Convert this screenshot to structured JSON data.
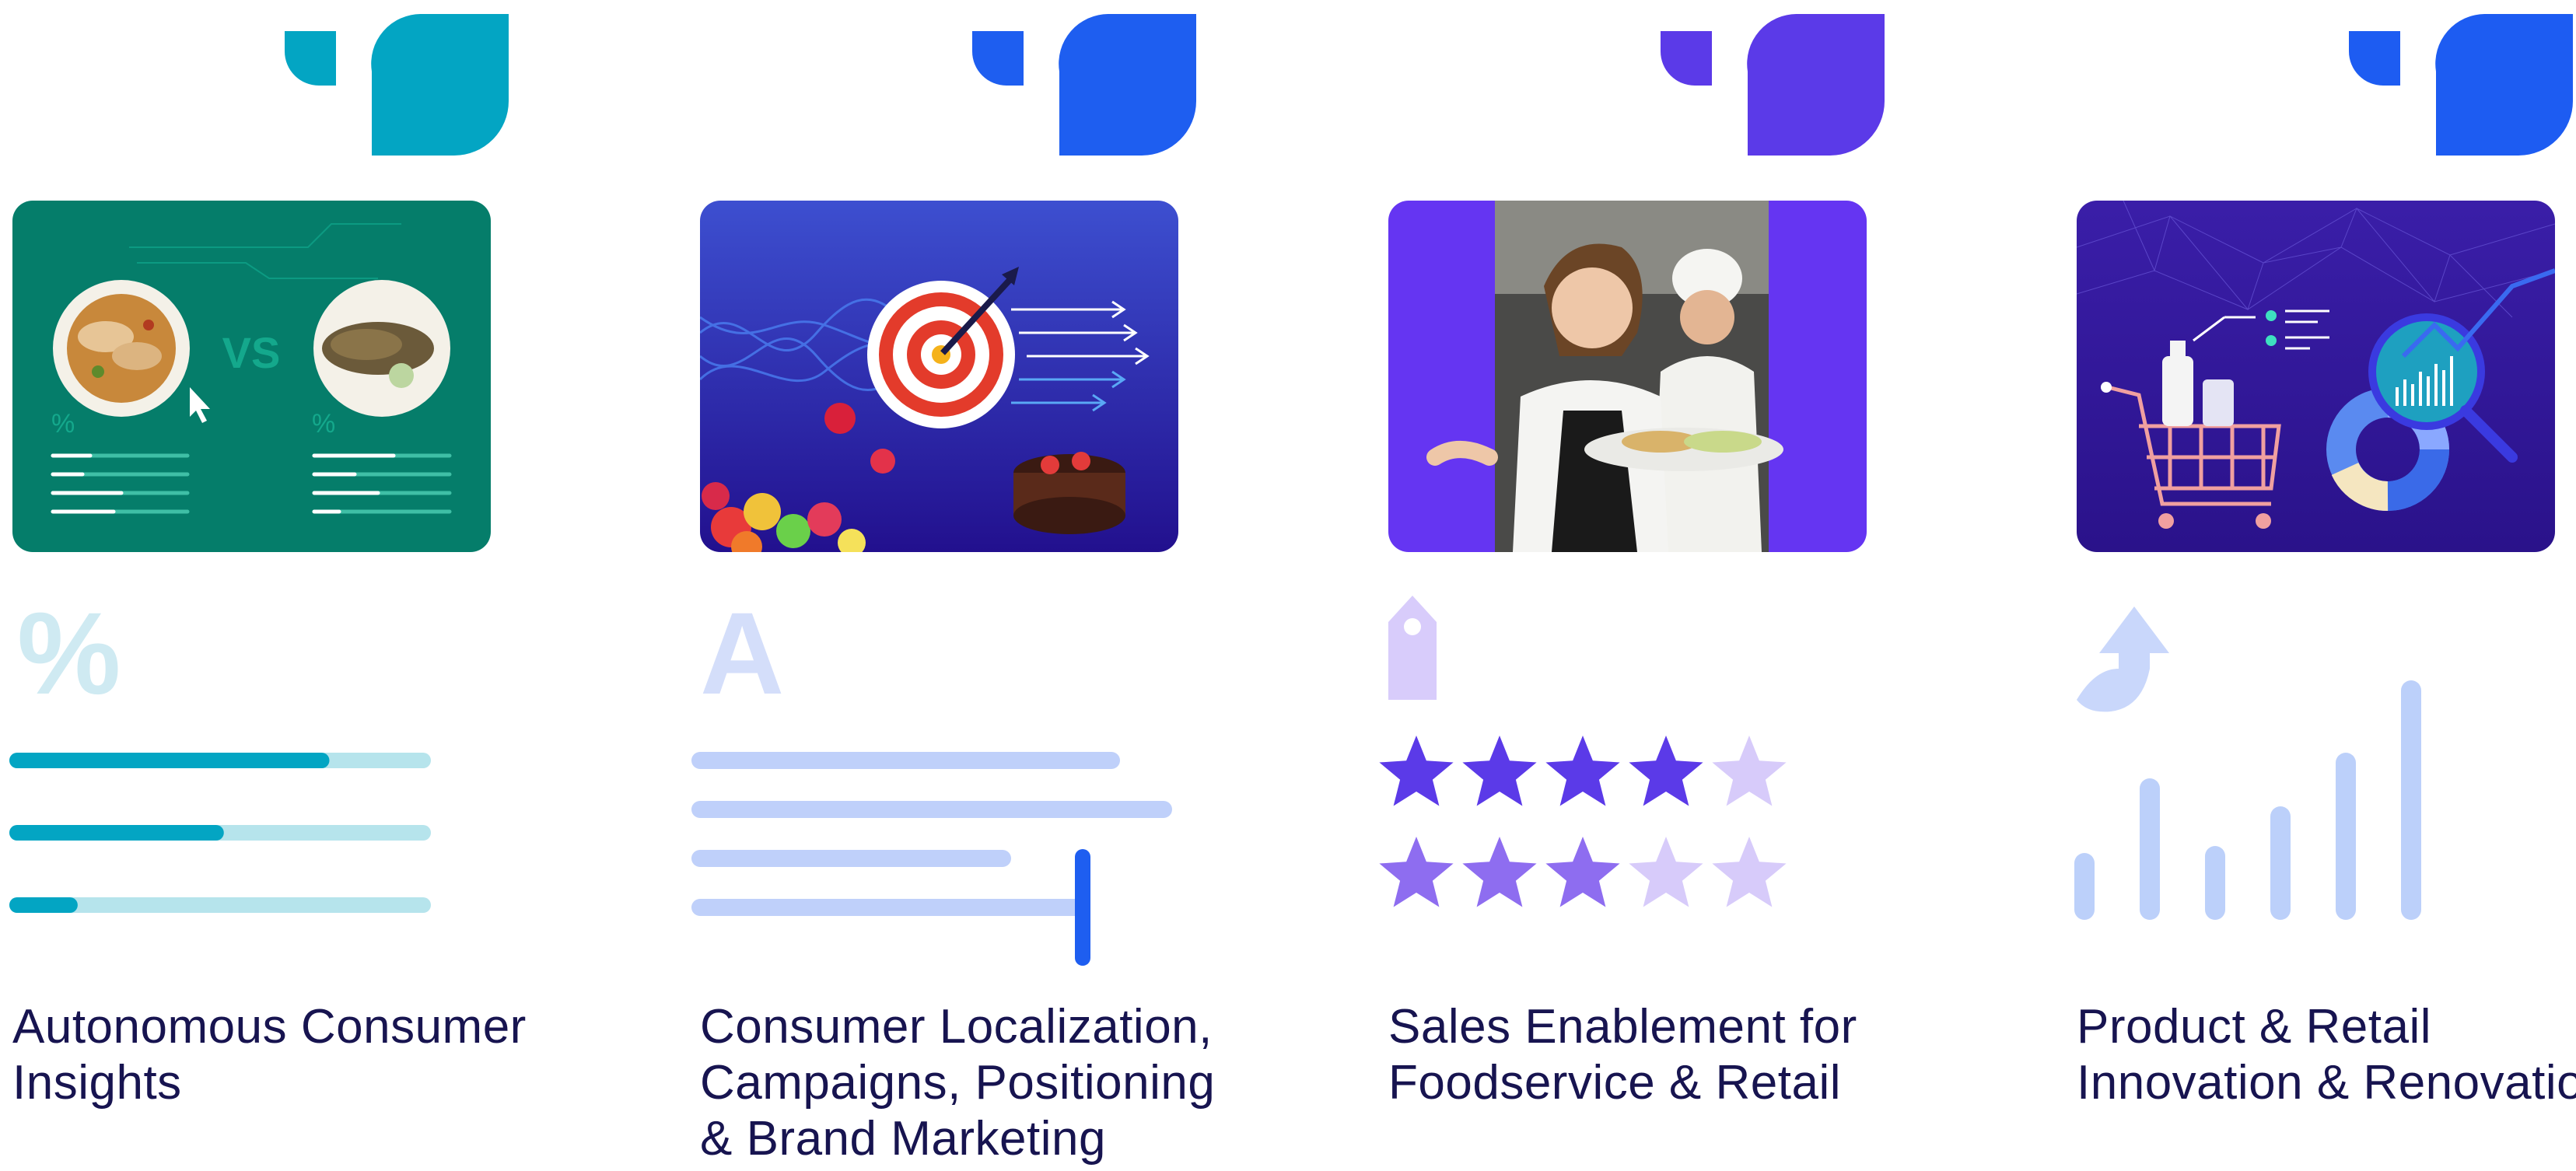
{
  "colors": {
    "teal": "#03a5c3",
    "blue": "#1e5ef0",
    "violet": "#5b3ae8",
    "royal": "#1d5cf2",
    "title": "#171450"
  },
  "cards": [
    {
      "logo_icon": "leaf-logo-icon",
      "image": "food-comparison-image",
      "image_text": {
        "vs": "VS",
        "pct_left": "%",
        "pct_right": "%"
      },
      "illustration_icon": "percent-icon",
      "illustration_symbol": "%",
      "progress": [
        0.75,
        0.49,
        0.13
      ],
      "title": "Autonomous Consumer Insights"
    },
    {
      "logo_icon": "leaf-logo-icon",
      "image": "target-campaign-image",
      "illustration_icon": "text-letter-icon",
      "illustration_symbol": "A",
      "title": "Consumer Localization, Campaigns, Positioning & Brand Marketing"
    },
    {
      "logo_icon": "leaf-logo-icon",
      "image": "foodservice-staff-image",
      "illustration_icon": "price-tag-icon",
      "ratings": [
        4,
        3
      ],
      "title": "Sales Enablement for Foodservice & Retail"
    },
    {
      "logo_icon": "leaf-logo-icon",
      "image": "retail-analytics-image",
      "illustration_icon": "up-arrow-icon",
      "bars": [
        0.2,
        0.52,
        0.23,
        0.4,
        0.63,
        0.94
      ],
      "title": "Product & Retail Innovation & Renovation"
    }
  ]
}
